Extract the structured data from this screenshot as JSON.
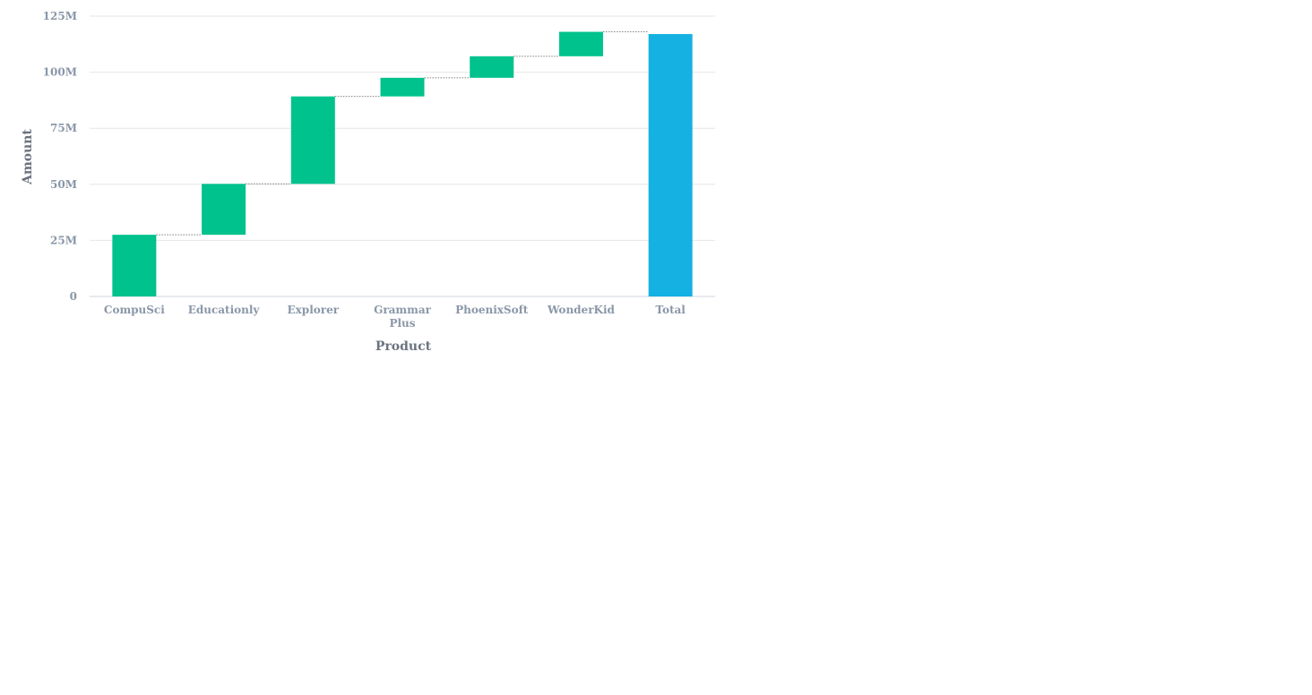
{
  "chart_data": {
    "type": "bar",
    "subtype": "waterfall",
    "title": "",
    "xlabel": "Product",
    "ylabel": "Amount",
    "categories": [
      "CompuSci",
      "Educationly",
      "Explorer",
      "Grammar Plus",
      "PhoenixSoft",
      "WonderKid",
      "Total"
    ],
    "values": [
      27.5,
      22.7,
      39.0,
      8.3,
      9.6,
      10.9,
      117.0
    ],
    "is_total": [
      false,
      false,
      false,
      false,
      false,
      false,
      true
    ],
    "value_unit": "M",
    "ylim": [
      0,
      125
    ],
    "yticks": [
      0,
      25,
      50,
      75,
      100,
      125
    ],
    "ytick_labels": [
      "0",
      "25M",
      "50M",
      "75M",
      "100M",
      "125M"
    ],
    "grid": true,
    "legend": "none",
    "colors": {
      "increase": "#00c28c",
      "total": "#14b1e2",
      "grid": "#e6e6e6",
      "connector": "#7f7f7f"
    }
  }
}
